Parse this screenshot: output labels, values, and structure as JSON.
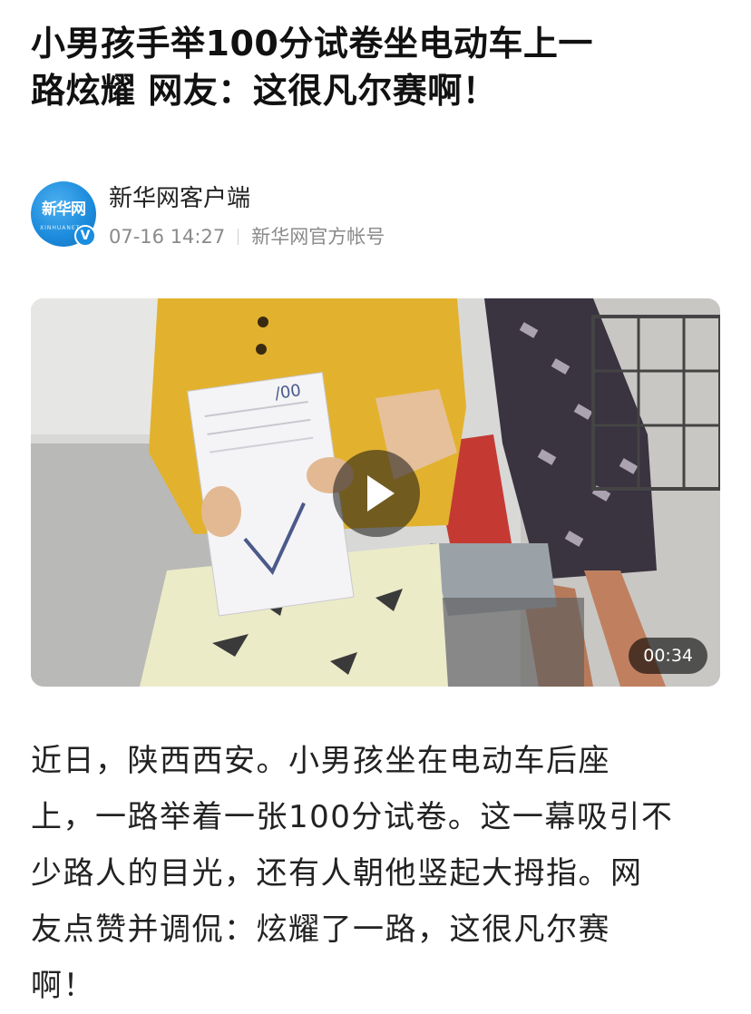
{
  "article": {
    "title_lines": [
      "小男孩手举100分试卷坐电动车上一",
      "路炫耀 网友：这很凡尔赛啊！"
    ]
  },
  "author": {
    "avatar_text": "新华网",
    "avatar_subtext": "XINHUANET",
    "verified_mark": "V",
    "name": "新华网客户端",
    "date": "07-16 14:27",
    "account_type": "新华网官方帐号"
  },
  "video": {
    "duration": "00:34",
    "play_icon": "play-icon"
  },
  "body": {
    "lines": [
      "近日，陕西西安。小男孩坐在电动车后座",
      "上，一路举着一张100分试卷。这一幕吸引不",
      "少路人的目光，还有人朝他竖起大拇指。网",
      "友点赞并调侃：炫耀了一路，这很凡尔赛",
      "啊！"
    ]
  },
  "colors": {
    "brand_blue": "#1e8ddd",
    "text": "#222222",
    "meta_text": "#8a8a8a"
  }
}
